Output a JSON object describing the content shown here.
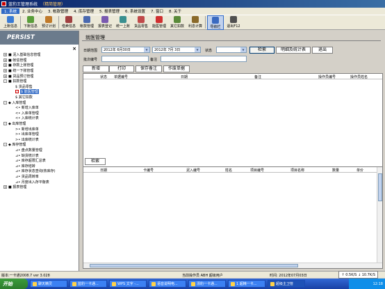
{
  "window": {
    "title": "蓝豹王管理系统",
    "subtitle": "（精简管理）"
  },
  "menubar": [
    "1. 系统",
    "2. 业务中心",
    "3. 帐款管理",
    "4. 库存管理",
    "5. 报表管理",
    "6. 系统设置",
    "7. 窗口",
    "8. 关于"
  ],
  "toolbar": [
    {
      "label": "上账信息",
      "icon": "upload-icon",
      "color": "#3a7bd5"
    },
    {
      "label": "下账信息",
      "icon": "download-icon",
      "color": "#5a9e3a"
    },
    {
      "label": "预订计划",
      "icon": "calendar-icon",
      "color": "#c07a2a"
    },
    {
      "label": "借卖信息",
      "icon": "note-icon",
      "color": "#a04040"
    },
    {
      "label": "帐款管理",
      "icon": "ledger-icon",
      "color": "#4a6ab0"
    },
    {
      "label": "报表登记",
      "icon": "report-icon",
      "color": "#7a5ab0"
    },
    {
      "label": "统一上账",
      "icon": "stack-icon",
      "color": "#3a9090"
    },
    {
      "label": "货品零售",
      "icon": "cart-icon",
      "color": "#c04a4a"
    },
    {
      "label": "能医管理",
      "icon": "cross-icon",
      "color": "#d03030"
    },
    {
      "label": "其它扣款",
      "icon": "money-icon",
      "color": "#5a8a3a"
    },
    {
      "label": "利息计算",
      "icon": "calc-icon",
      "color": "#8a6a2a"
    },
    {
      "label": "导航栏",
      "icon": "nav-icon",
      "color": "#3a6ac0"
    },
    {
      "label": "退出F12",
      "icon": "exit-icon",
      "color": "#505050"
    }
  ],
  "sidebar": {
    "header": "PERSIST",
    "close": "×",
    "items": [
      {
        "label": "■ 泥入基础信息管理",
        "level": 0,
        "exp": "+"
      },
      {
        "label": "■ 帐信管理",
        "level": 0,
        "exp": "+"
      },
      {
        "label": "■ 存款上账管理",
        "level": 0,
        "exp": "+"
      },
      {
        "label": "■ 统一下账管理",
        "level": 0,
        "exp": "+"
      },
      {
        "label": "■ 货品预订管理",
        "level": 0,
        "exp": "+"
      },
      {
        "label": "■ 扣款管理",
        "level": 0,
        "exp": "-"
      },
      {
        "label": "$ 货品零售",
        "level": 1
      },
      {
        "label": "$ 能医管理",
        "level": 1,
        "selected": true,
        "check": true
      },
      {
        "label": "$ 其它扣款",
        "level": 1
      },
      {
        "label": "◆ 入库管理",
        "level": 0,
        "exp": "-"
      },
      {
        "label": "<• 新增入库单",
        "level": 1
      },
      {
        "label": "<• 入库单管理",
        "level": 1
      },
      {
        "label": "<• 入库统计表",
        "level": 1
      },
      {
        "label": "◆ 出库管理",
        "level": 0,
        "exp": "-"
      },
      {
        "label": ">• 新增出库单",
        "level": 1
      },
      {
        "label": ">• 出库单管理",
        "level": 1
      },
      {
        "label": ">• 出库统计表",
        "level": 1
      },
      {
        "label": "◆ 库存管理",
        "level": 0,
        "exp": "-"
      },
      {
        "label": "⊿• 盘点数量管理",
        "level": 1
      },
      {
        "label": "⊿• 缺货统计表",
        "level": 1
      },
      {
        "label": "⊿• 库存超限汇总表",
        "level": 1
      },
      {
        "label": "⊿• 库存结转",
        "level": 1
      },
      {
        "label": "⊿• 库存状态查询(热库存)",
        "level": 1
      },
      {
        "label": "⊿• 货品周转率",
        "level": 1
      },
      {
        "label": "⊿• 月度出入存平衡表",
        "level": 1
      },
      {
        "label": "■ 报表管理",
        "level": 0,
        "exp": "+"
      }
    ]
  },
  "main": {
    "title": "就医管理",
    "date_range_label": "日期范围",
    "date_from": "2012年 6月30日",
    "date_to": "2012年 7月 3日",
    "status_label": "状态",
    "status_value": "",
    "search_btn": "检索",
    "stats_btn": "明细及统计表",
    "exit_btn": "退出",
    "batch_label": "批次编号",
    "remark_label": "备注",
    "add_btn": "新增",
    "print_btn": "打印",
    "save_remark_btn": "保存备注",
    "void_btn": "作废单据",
    "top_grid_headers": [
      "状态",
      "单据编号",
      "日期",
      "备注",
      "操作员编号",
      "操作员姓名"
    ],
    "bottom_search_btn": "检索",
    "bottom_grid_headers": [
      "日期",
      "卡编号",
      "泥入编号",
      "姓名",
      "项目编号",
      "项目名称",
      "数量",
      "单价"
    ]
  },
  "statusbar": {
    "version": "版本:一卡通2008.7 ver 3.028",
    "operator": "当前操作员 ABH 超级用户",
    "time": "时间: 2012年07月03日",
    "speed": "↑ 0.5K/S ↓ 10.7K/S"
  },
  "taskbar": {
    "start": "开始",
    "tasks": [
      "聊天精灵",
      "蓝豹一卡通...",
      "WPS 文字 -...",
      "语音说明电...",
      "漂豹一卡通...",
      "1 超精一卡...",
      "超级主卫管"
    ],
    "clock": "12:18"
  }
}
